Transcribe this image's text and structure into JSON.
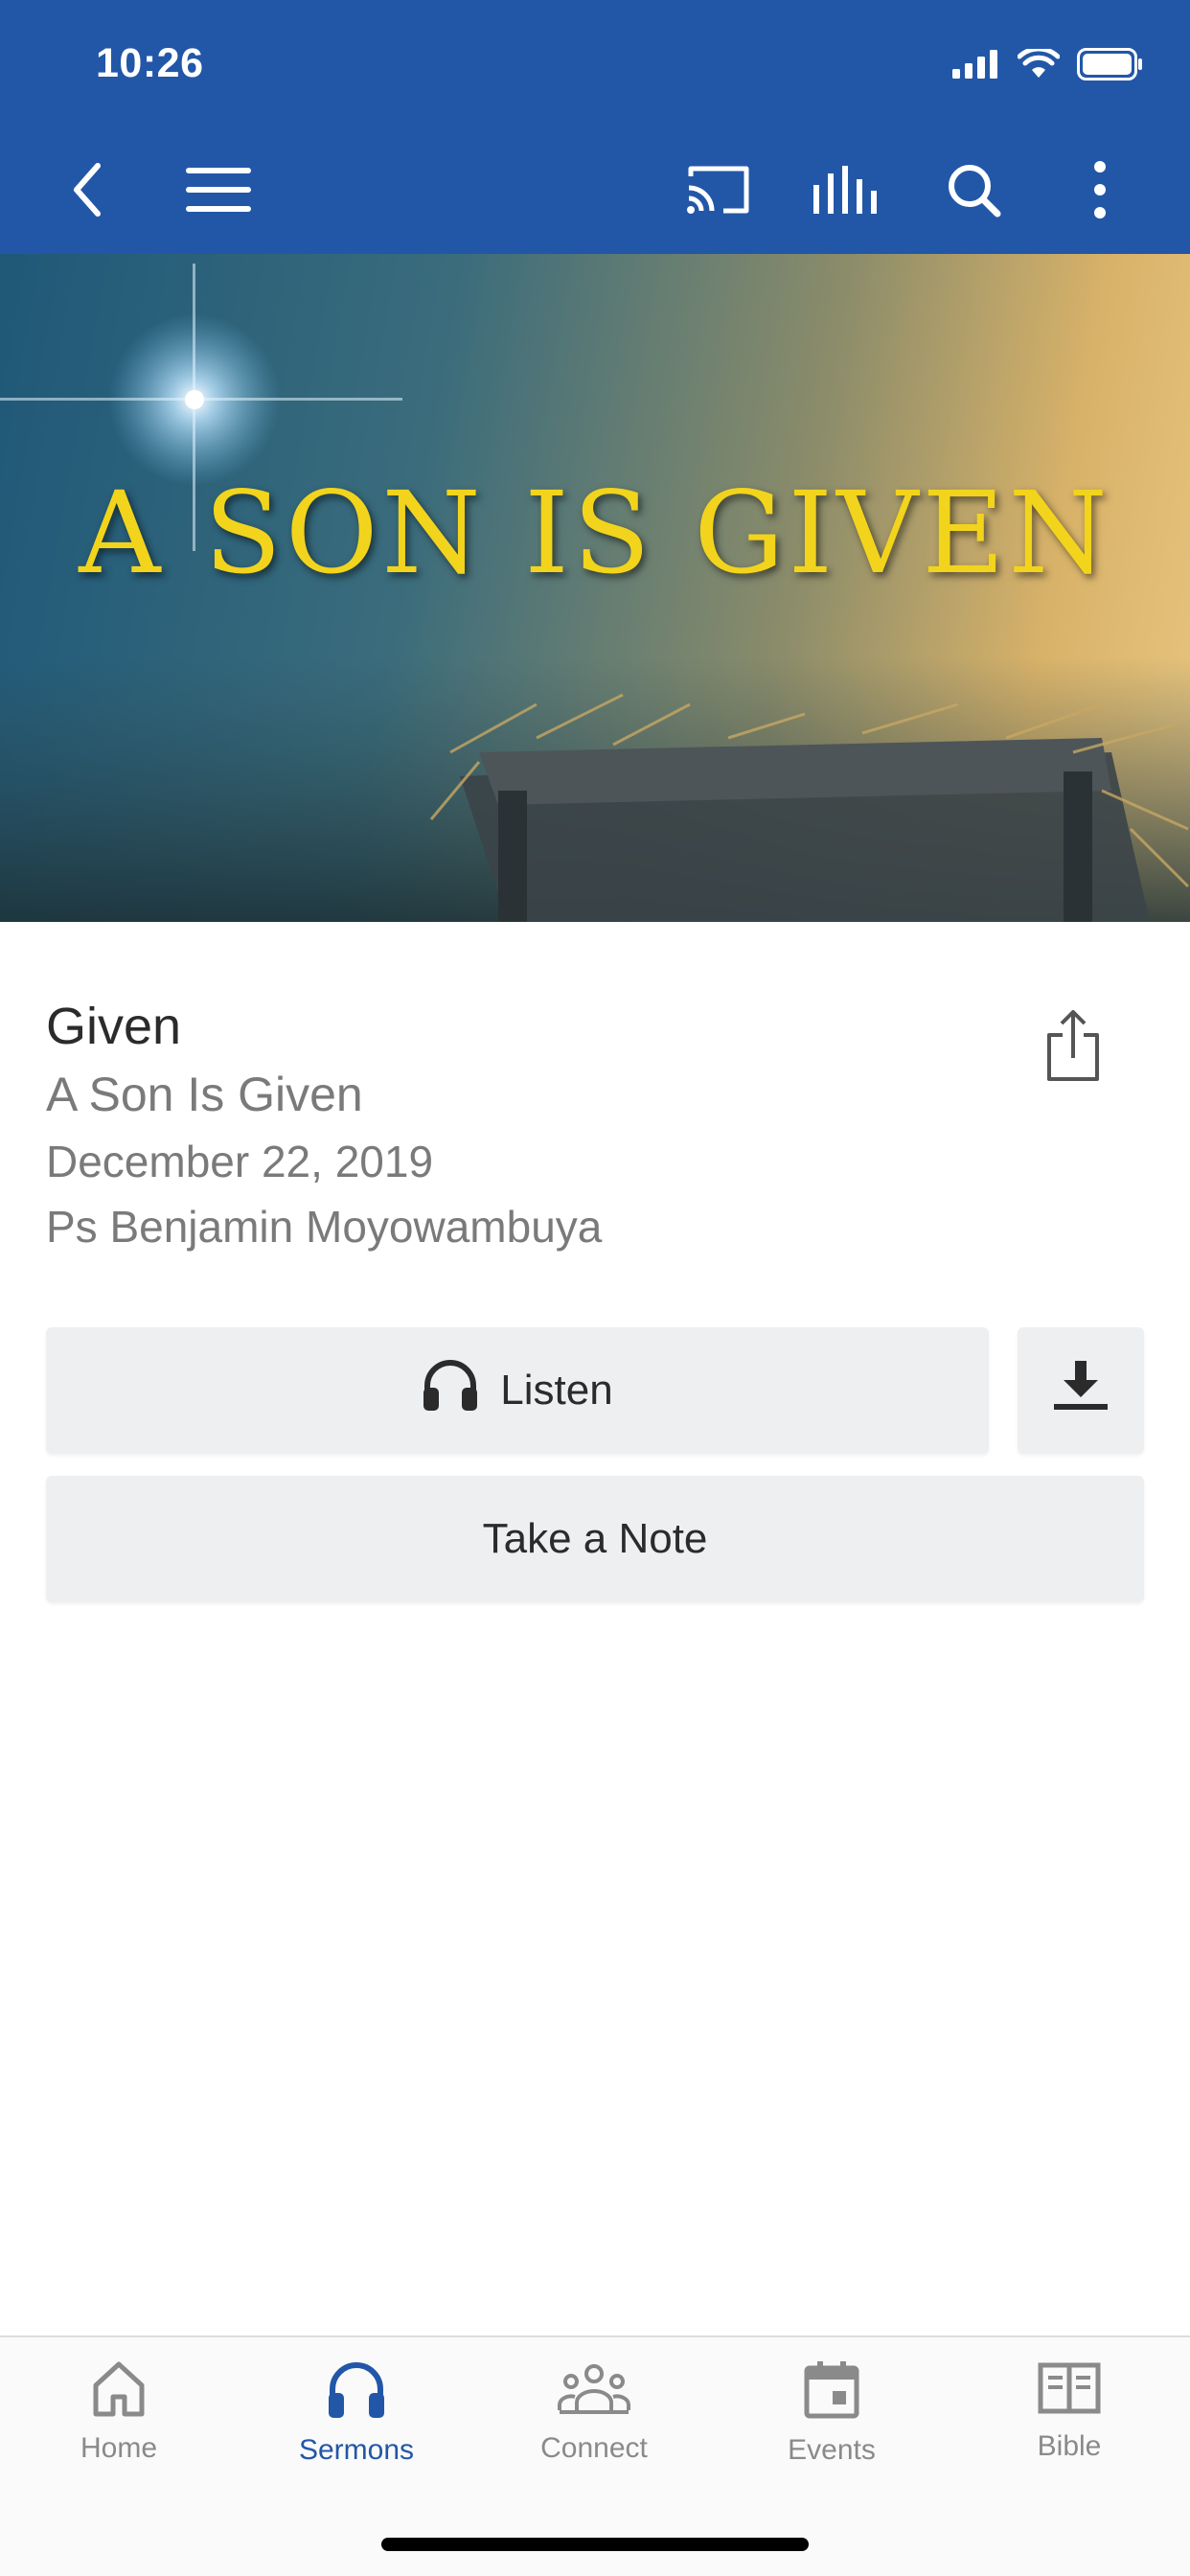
{
  "status_bar": {
    "time": "10:26"
  },
  "toolbar": {
    "back_icon": "chevron-left-icon",
    "menu_icon": "hamburger-icon",
    "cast_icon": "cast-icon",
    "audio_icon": "equalizer-icon",
    "search_icon": "search-icon",
    "more_icon": "more-vertical-icon"
  },
  "hero": {
    "title": "A SON IS GIVEN"
  },
  "sermon": {
    "title": "Given",
    "series": "A Son Is Given",
    "date": "December 22, 2019",
    "speaker": "Ps Benjamin Moyowambuya"
  },
  "actions": {
    "listen_label": "Listen",
    "take_note_label": "Take a Note"
  },
  "tabs": [
    {
      "label": "Home",
      "icon": "home-icon",
      "active": false
    },
    {
      "label": "Sermons",
      "icon": "headphones-icon",
      "active": true
    },
    {
      "label": "Connect",
      "icon": "people-icon",
      "active": false
    },
    {
      "label": "Events",
      "icon": "calendar-icon",
      "active": false
    },
    {
      "label": "Bible",
      "icon": "book-icon",
      "active": false
    }
  ],
  "colors": {
    "brand_blue": "#2257a8",
    "tab_inactive": "#8a8a8a",
    "button_bg": "#eeeff1",
    "hero_title": "#f2d41c"
  }
}
